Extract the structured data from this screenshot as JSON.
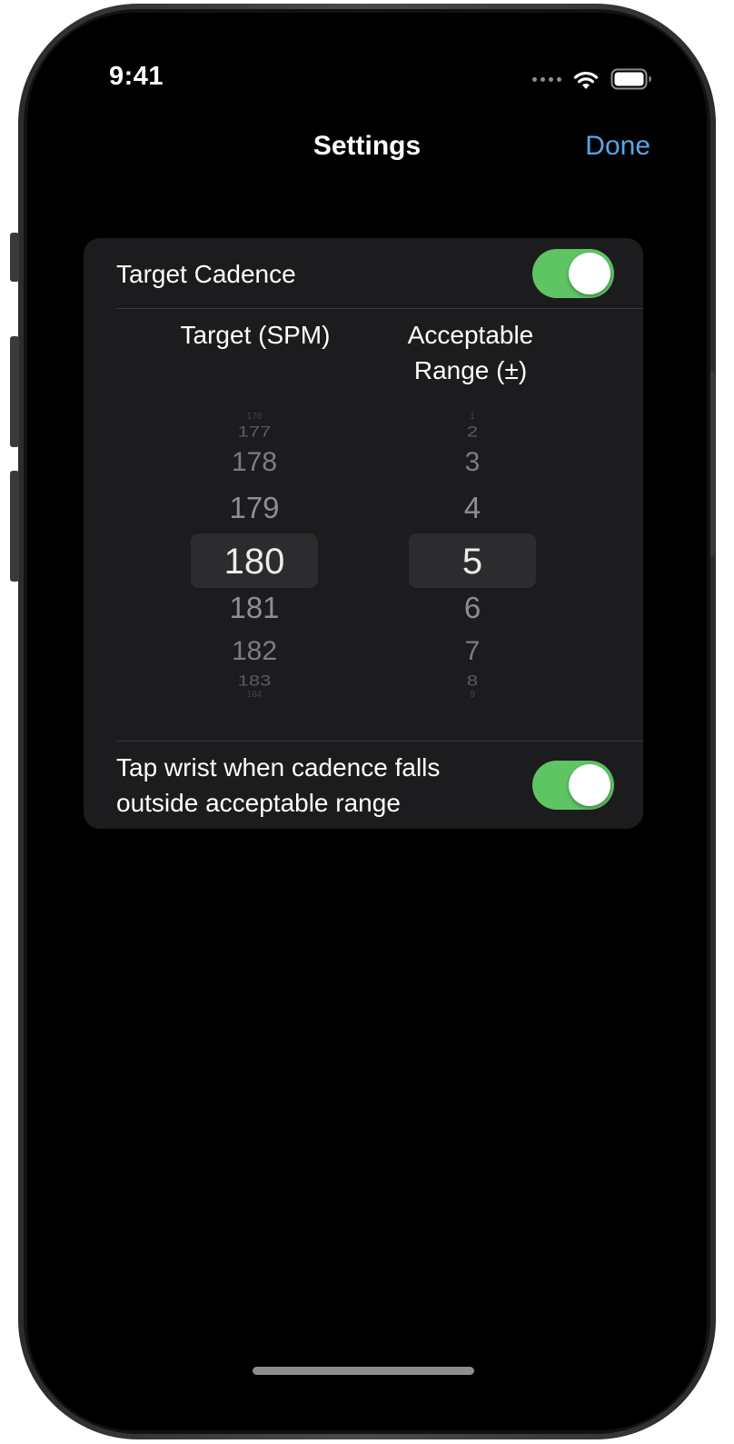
{
  "status_bar": {
    "time": "9:41"
  },
  "nav": {
    "title": "Settings",
    "done_label": "Done"
  },
  "settings": {
    "target_cadence": {
      "label": "Target Cadence",
      "enabled": true
    },
    "target_column": {
      "header": "Target (SPM)"
    },
    "range_column": {
      "header_line1": "Acceptable",
      "header_line2": "Range (±)"
    },
    "spm_picker": {
      "items": [
        "176",
        "177",
        "178",
        "179",
        "180",
        "181",
        "182",
        "183",
        "184"
      ],
      "selected": "180"
    },
    "range_picker": {
      "items": [
        "1",
        "2",
        "3",
        "4",
        "5",
        "6",
        "7",
        "8",
        "9"
      ],
      "selected": "5"
    },
    "tap_wrist": {
      "label_line1": "Tap wrist when cadence falls",
      "label_line2": "outside acceptable range",
      "enabled": true
    }
  },
  "colors": {
    "accent": "#58a6e8",
    "toggle_on": "#5fc564",
    "card_bg": "#1c1c1e",
    "screen_bg": "#000000"
  },
  "icons": {
    "signal": "cellular-dots-icon",
    "wifi": "wifi-icon",
    "battery": "battery-icon"
  }
}
